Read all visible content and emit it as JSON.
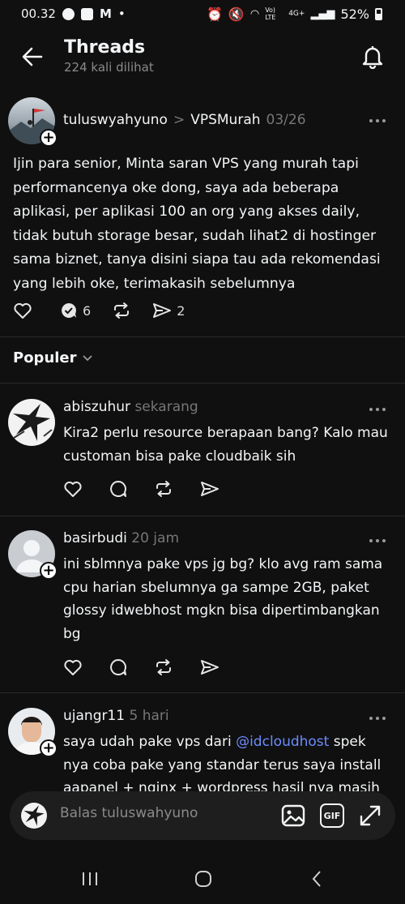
{
  "status_bar": {
    "time": "00.32",
    "battery": "52%",
    "network_top": "4G+",
    "volte": "Vo) LTE"
  },
  "header": {
    "title": "Threads",
    "subtitle": "224 kali dilihat"
  },
  "main_post": {
    "username": "tuluswyahyuno",
    "separator": ">",
    "community": "VPSMurah",
    "date": "03/26",
    "text": "Ijin para senior, Minta saran VPS yang murah tapi performancenya oke dong, saya ada beberapa aplikasi, per aplikasi 100 an org yang akses daily, tidak butuh storage besar, sudah lihat2 di hostinger sama biznet, tanya disini siapa tau ada rekomendasi yang lebih oke, terimakasih sebelumnya",
    "reply_count": "6",
    "share_count": "2"
  },
  "sort": {
    "label": "Populer"
  },
  "replies": [
    {
      "username": "abiszuhur",
      "time": "sekarang",
      "text": "Kira2 perlu resource berapaan bang? Kalo mau customan bisa pake cloudbaik sih"
    },
    {
      "username": "basirbudi",
      "time": "20 jam",
      "text": "ini sblmnya pake vps jg bg? klo  avg ram sama cpu harian sbelumnya ga sampe 2GB,  paket glossy idwebhost mgkn bisa dipertimbangkan bg"
    },
    {
      "username": "ujangr11",
      "time": "5 hari",
      "text_before": "saya udah pake vps dari ",
      "mention": "@idcloudhost",
      "text_after": " spek nya coba pake yang standar terus saya install aapanel + nginx + wordpress hasil nya masih"
    }
  ],
  "composer": {
    "placeholder": "Balas tuluswahyuno",
    "gif_label": "GIF"
  },
  "colors": {
    "background": "#101010",
    "text": "#f3f5f7",
    "muted": "#777777",
    "mention": "#6b8cff"
  }
}
